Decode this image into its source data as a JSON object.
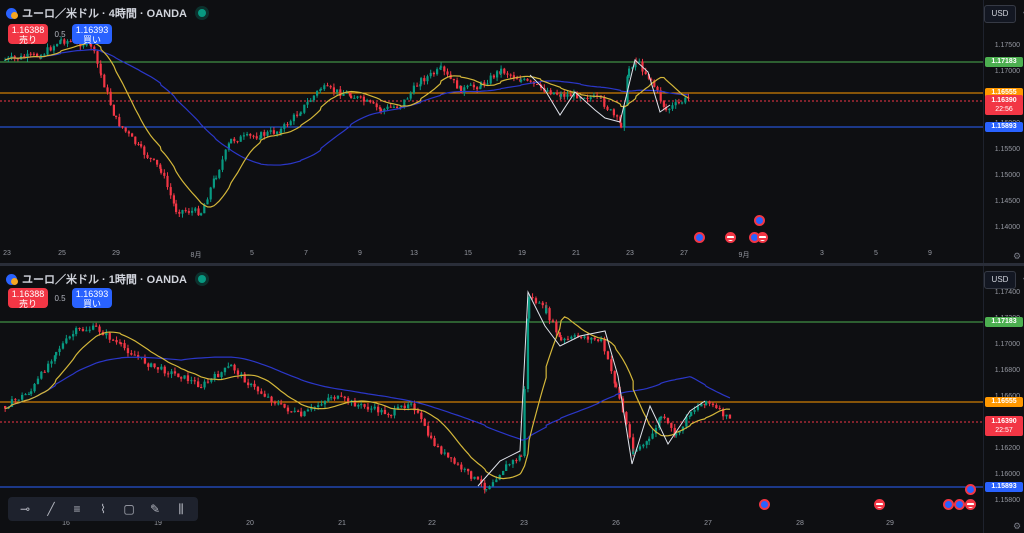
{
  "colors": {
    "bull": "#089981",
    "bear": "#f23645",
    "ma_fast": "#d4b73a",
    "ma_slow": "#2b37c9",
    "green": "#4caf50",
    "orange": "#ff9800",
    "blue": "#2962ff",
    "red": "#f23645"
  },
  "top": {
    "title": "ユーロ／米ドル · 4時間 · OANDA",
    "sell_price": "1.16388",
    "sell_label": "売り",
    "spread": "0.5",
    "buy_price": "1.16393",
    "buy_label": "買い",
    "currency": "USD",
    "y_ticks": [
      "1.17500",
      "1.17000",
      "1.16500",
      "1.16000",
      "1.15500",
      "1.15000",
      "1.14500",
      "1.14000"
    ],
    "x_ticks": [
      "23",
      "25",
      "29",
      "8月",
      "5",
      "7",
      "9",
      "13",
      "15",
      "19",
      "21",
      "23",
      "27",
      "9月",
      "3",
      "5",
      "9"
    ],
    "levels": {
      "green": "1.17183",
      "orange": "1.16555",
      "current": "1.16390",
      "countdown": "22:56",
      "blue": "1.15893"
    }
  },
  "bottom": {
    "title": "ユーロ／米ドル · 1時間 · OANDA",
    "sell_price": "1.16388",
    "sell_label": "売り",
    "spread": "0.5",
    "buy_price": "1.16393",
    "buy_label": "買い",
    "currency": "USD",
    "y_ticks": [
      "1.17400",
      "1.17200",
      "1.17000",
      "1.16800",
      "1.16600",
      "1.16400",
      "1.16200",
      "1.16000",
      "1.15800"
    ],
    "x_ticks": [
      "16",
      "19",
      "20",
      "21",
      "22",
      "23",
      "26",
      "27",
      "28",
      "29"
    ],
    "levels": {
      "green": "1.17183",
      "orange": "1.16555",
      "current": "1.16390",
      "countdown": "22:57",
      "blue": "1.15893"
    }
  },
  "toolbar": [
    "crosshair-icon",
    "trend-line-icon",
    "fib-icon",
    "pattern-icon",
    "rectangle-icon",
    "brush-icon",
    "indicator-icon"
  ]
}
